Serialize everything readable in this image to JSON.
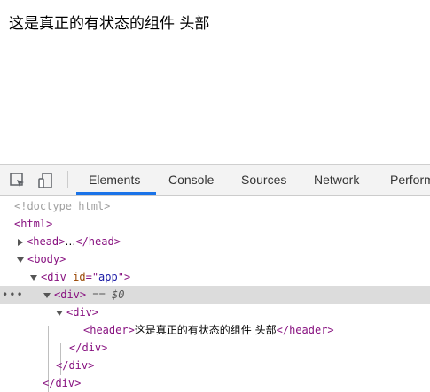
{
  "page": {
    "header_text": "这是真正的有状态的组件 头部"
  },
  "devtools": {
    "tabs": [
      {
        "label": "Elements",
        "active": true
      },
      {
        "label": "Console",
        "active": false
      },
      {
        "label": "Sources",
        "active": false
      },
      {
        "label": "Network",
        "active": false
      },
      {
        "label": "Perform",
        "active": false
      }
    ],
    "icons": [
      "inspect-element-icon",
      "device-toolbar-icon"
    ],
    "accent_color": "#1a73e8"
  },
  "tree": {
    "doctype": "<!doctype html>",
    "html_open": "<html>",
    "head_open": "<head>",
    "head_ellipsis": "…",
    "head_close": "</head>",
    "body_open": "<body>",
    "div_app_open": "<div",
    "div_app_attr_name": "id",
    "div_app_attr_eq": "=\"",
    "div_app_attr_value": "app",
    "div_app_attr_end": "\">",
    "div_selected_open": "<div>",
    "selected_marker": "== $0",
    "div_inner_open": "<div>",
    "header_open": "<header>",
    "header_text": "这是真正的有状态的组件 头部",
    "header_close": "</header>",
    "div_inner_close": "</div>",
    "div_selected_close": "</div>",
    "div_app_close": "</div>"
  }
}
